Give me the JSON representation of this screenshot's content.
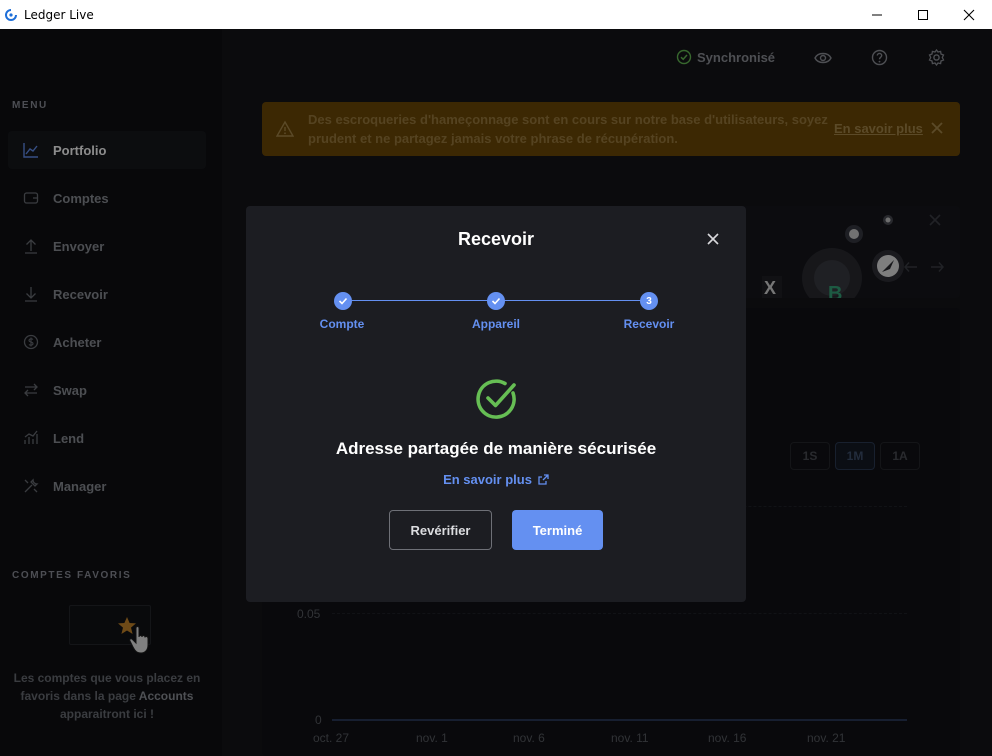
{
  "window": {
    "title": "Ledger Live",
    "minimize_icon": "minimize-icon",
    "maximize_icon": "maximize-icon",
    "close_icon": "close-icon"
  },
  "sidebar": {
    "menu_title": "MENU",
    "items": [
      {
        "label": "Portfolio",
        "icon": "chart-icon",
        "active": true
      },
      {
        "label": "Comptes",
        "icon": "wallet-icon",
        "active": false
      },
      {
        "label": "Envoyer",
        "icon": "arrow-up-icon",
        "active": false
      },
      {
        "label": "Recevoir",
        "icon": "arrow-down-icon",
        "active": false
      },
      {
        "label": "Acheter",
        "icon": "dollar-icon",
        "active": false
      },
      {
        "label": "Swap",
        "icon": "swap-icon",
        "active": false
      },
      {
        "label": "Lend",
        "icon": "lend-icon",
        "active": false
      },
      {
        "label": "Manager",
        "icon": "tools-icon",
        "active": false
      }
    ],
    "favorites_title": "COMPTES FAVORIS",
    "favorites_text_1": "Les comptes que vous placez en favoris dans la page",
    "favorites_text_strong": "Accounts",
    "favorites_text_2": "apparaitront ici !"
  },
  "topbar": {
    "sync_label": "Synchronisé"
  },
  "banner": {
    "message": "Des escroqueries d'hameçonnage sont en cours sur notre base d'utilisateurs, soyez prudent et ne partagez jamais votre phrase de récupération.",
    "link": "En savoir plus"
  },
  "chart": {
    "ranges": [
      "1S",
      "1M",
      "1A"
    ],
    "selected_range": "1M",
    "y_ticks": [
      "0.05",
      "0"
    ],
    "x_ticks": [
      "oct. 27",
      "nov. 1",
      "nov. 6",
      "nov. 11",
      "nov. 16",
      "nov. 21"
    ]
  },
  "modal": {
    "title": "Recevoir",
    "steps": [
      {
        "label": "Compte",
        "state": "done"
      },
      {
        "label": "Appareil",
        "state": "done"
      },
      {
        "label": "Recevoir",
        "state": "current",
        "number": "3"
      }
    ],
    "success_title": "Adresse partagée de manière sécurisée",
    "learn_more": "En savoir plus",
    "recheck_button": "Revérifier",
    "done_button": "Terminé",
    "accent_color": "#6490f1",
    "success_color": "#66be54"
  }
}
